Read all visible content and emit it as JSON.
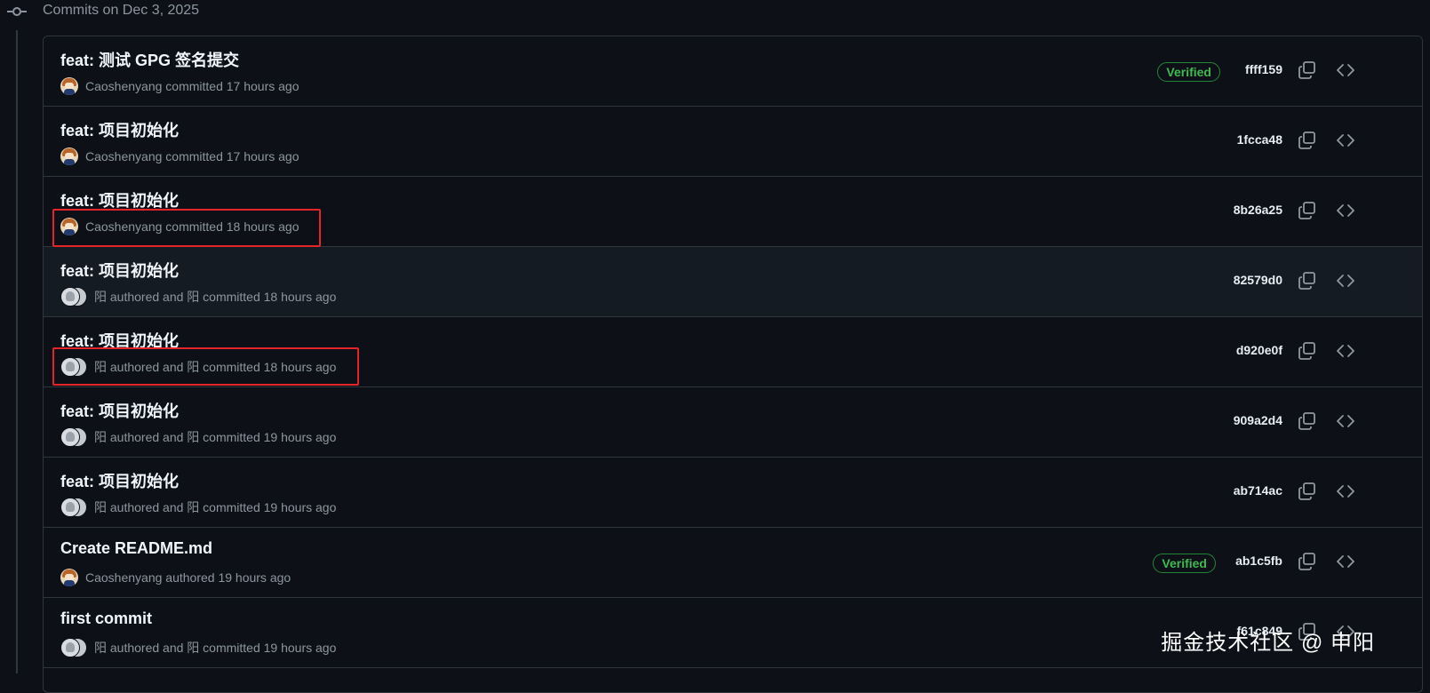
{
  "header": {
    "title": "Commits on Dec 3, 2025",
    "icon": "git-commit-icon"
  },
  "commits": [
    {
      "message": "feat: 测试 GPG 签名提交",
      "meta": "Caoshenyang committed 17 hours ago",
      "avatar": "user",
      "verified": "Verified",
      "sha": "ffff159"
    },
    {
      "message": "feat: 项目初始化",
      "meta": "Caoshenyang committed 17 hours ago",
      "avatar": "user",
      "verified": "",
      "sha": "1fcca48"
    },
    {
      "message": "feat: 项目初始化",
      "meta": "Caoshenyang committed 18 hours ago",
      "avatar": "user",
      "verified": "",
      "sha": "8b26a25"
    },
    {
      "message": "feat: 项目初始化",
      "meta": "阳 authored and 阳 committed 18 hours ago",
      "avatar": "pair",
      "verified": "",
      "sha": "82579d0"
    },
    {
      "message": "feat: 项目初始化",
      "meta": "阳 authored and 阳 committed 18 hours ago",
      "avatar": "pair",
      "verified": "",
      "sha": "d920e0f"
    },
    {
      "message": "feat: 项目初始化",
      "meta": "阳 authored and 阳 committed 19 hours ago",
      "avatar": "pair",
      "verified": "",
      "sha": "909a2d4"
    },
    {
      "message": "feat: 项目初始化",
      "meta": "阳 authored and 阳 committed 19 hours ago",
      "avatar": "pair",
      "verified": "",
      "sha": "ab714ac"
    },
    {
      "message": "Create README.md",
      "meta": "Caoshenyang authored 19 hours ago",
      "avatar": "user",
      "verified": "Verified",
      "sha": "ab1c5fb"
    },
    {
      "message": "first commit",
      "meta": "阳 authored and 阳 committed 19 hours ago",
      "avatar": "pair",
      "verified": "",
      "sha": "f61c849"
    }
  ],
  "watermark": "掘金技术社区 @ 申阳",
  "colors": {
    "background": "#0d1117",
    "border": "#30363d",
    "verified": "#3fb950",
    "highlight": "#e5242a"
  }
}
